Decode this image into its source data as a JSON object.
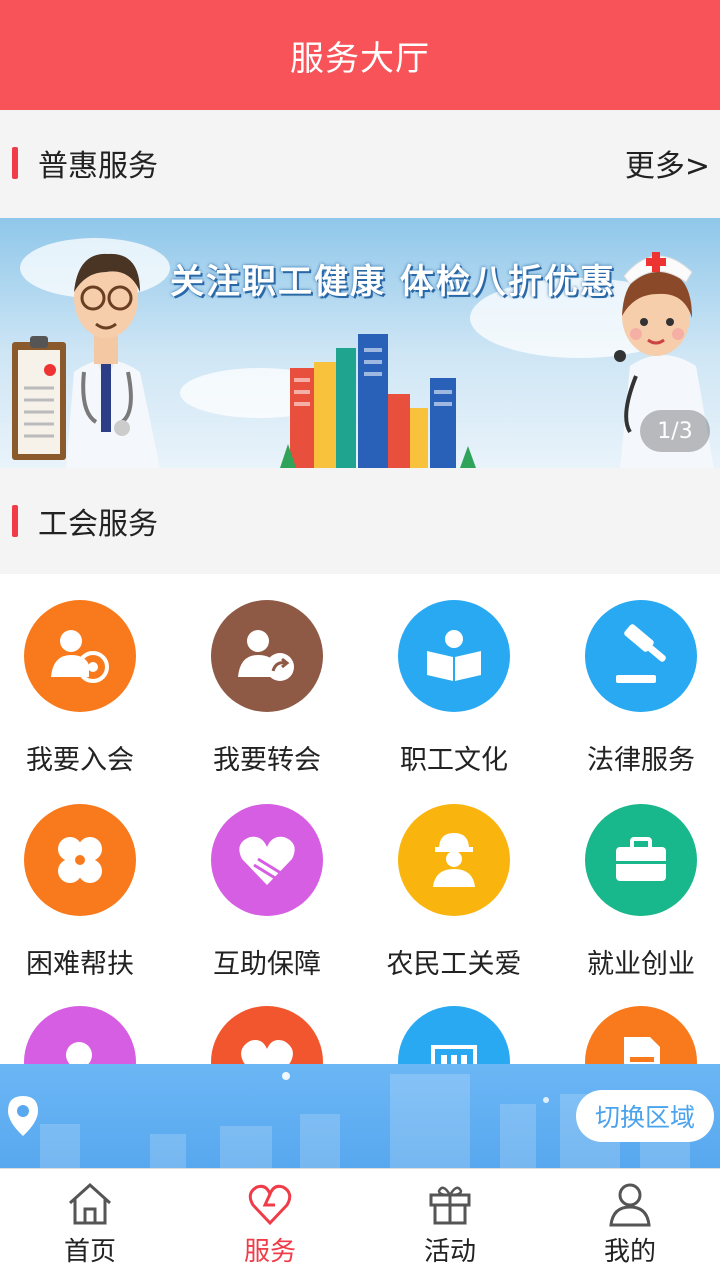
{
  "header": {
    "title": "服务大厅"
  },
  "sections": {
    "puhui": {
      "title": "普惠服务",
      "more": "更多>"
    },
    "gonghui": {
      "title": "工会服务"
    }
  },
  "banner": {
    "headline": "关注职工健康 体检八折优惠",
    "pager": "1/3"
  },
  "services": [
    {
      "label": "我要入会",
      "icon": "member-join-icon",
      "color": "#f97a1c"
    },
    {
      "label": "我要转会",
      "icon": "member-transfer-icon",
      "color": "#8e5a46"
    },
    {
      "label": "职工文化",
      "icon": "reading-icon",
      "color": "#28a9f2"
    },
    {
      "label": "法律服务",
      "icon": "gavel-icon",
      "color": "#28a9f2"
    },
    {
      "label": "困难帮扶",
      "icon": "clover-icon",
      "color": "#f97a1c"
    },
    {
      "label": "互助保障",
      "icon": "heart-hand-icon",
      "color": "#d65ee2"
    },
    {
      "label": "农民工关爱",
      "icon": "worker-icon",
      "color": "#f9b50e"
    },
    {
      "label": "就业创业",
      "icon": "briefcase-icon",
      "color": "#19b88c"
    },
    {
      "label": "",
      "icon": "female-profile-icon",
      "color": "#d65ee2"
    },
    {
      "label": "",
      "icon": "heart-icon",
      "color": "#f2562e"
    },
    {
      "label": "",
      "icon": "building-icon",
      "color": "#28a9f2"
    },
    {
      "label": "",
      "icon": "document-icon",
      "color": "#f97a1c"
    }
  ],
  "region": {
    "switch_label": "切换区域"
  },
  "tabbar": [
    {
      "label": "首页",
      "icon": "home-icon",
      "active": false
    },
    {
      "label": "服务",
      "icon": "heart-outline-icon",
      "active": true
    },
    {
      "label": "活动",
      "icon": "gift-icon",
      "active": false
    },
    {
      "label": "我的",
      "icon": "user-icon",
      "active": false
    }
  ],
  "colors": {
    "brand": "#f9535a",
    "accent": "#f03c48",
    "region_bg": "#58a8ef"
  }
}
